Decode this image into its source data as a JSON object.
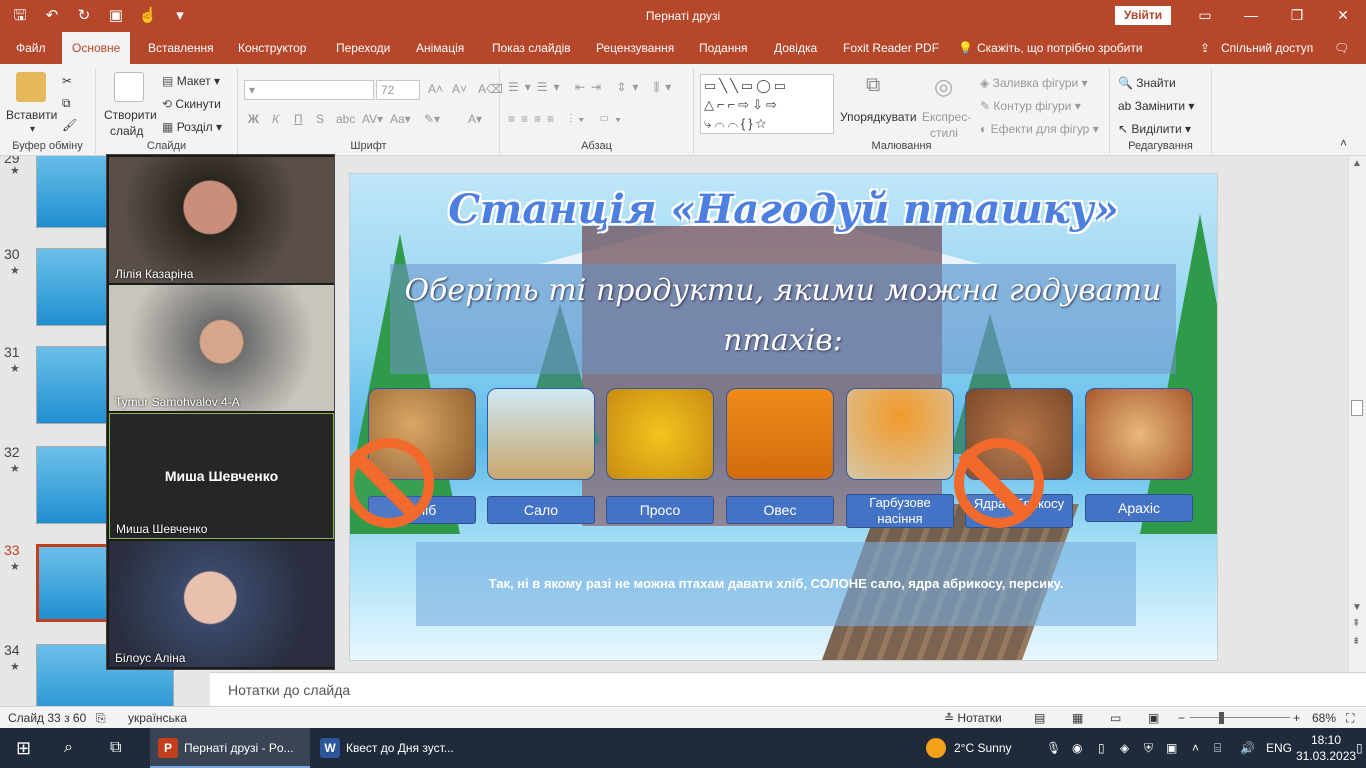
{
  "app": {
    "title": "Пернаті друзі",
    "signin": "Увійти"
  },
  "tabs": [
    "Файл",
    "Основне",
    "Вставлення",
    "Конструктор",
    "Переходи",
    "Анімація",
    "Показ слайдів",
    "Рецензування",
    "Подання",
    "Довідка",
    "Foxit Reader PDF",
    "Скажіть, що потрібно зробити",
    "Спільний доступ"
  ],
  "ribbon": {
    "paste": "Вставити",
    "clipboard": "Буфер обміну",
    "new_slide": "Створити",
    "new_slide2": "слайд",
    "layout": "Макет",
    "reset": "Скинути",
    "section": "Розділ",
    "slides": "Слайди",
    "font_size": "72",
    "bold": "Ж",
    "italic": "К",
    "underline": "П",
    "strike": "S",
    "font": "Шрифт",
    "paragraph": "Абзац",
    "arrange": "Упорядкувати",
    "quick_styles": "Експрес-",
    "quick_styles2": "стилі",
    "fill": "Заливка фігури",
    "outline": "Контур фігури",
    "effects": "Ефекти для фігур",
    "drawing": "Малювання",
    "find": "Знайти",
    "replace": "Замінити",
    "select": "Виділити",
    "editing": "Редагування"
  },
  "thumbnails": [
    {
      "num": "29"
    },
    {
      "num": "30"
    },
    {
      "num": "31"
    },
    {
      "num": "32"
    },
    {
      "num": "33"
    },
    {
      "num": "34"
    }
  ],
  "video": {
    "p1": "Лілія Казаріна",
    "p2": "Tymur Samohvalov 4-А",
    "p3_center": "Миша Шевченко",
    "p3": "Миша Шевченко",
    "p4": "Білоус Аліна"
  },
  "slide": {
    "title": "Станція «Нагодуй пташку»",
    "question": "Оберіть ті продукти, якими можна годувати птахів:",
    "foods": [
      "Хліб",
      "Сало",
      "Просо",
      "Овес",
      "Гарбузове насіння",
      "Ядра абрикосу",
      "Арахіс"
    ],
    "answer": "Так, ні в якому разі не можна птахам давати хліб, СОЛОНЕ сало, ядра абрикосу, персику."
  },
  "notes": "Нотатки до слайда",
  "status": {
    "slide": "Слайд 33 з 60",
    "lang": "українська",
    "notes_btn": "Нотатки",
    "zoom": "68%"
  },
  "taskbar": {
    "app1": "Пернаті друзі - Po...",
    "app2": "Квест  до Дня зуст...",
    "weather": "2°C  Sunny",
    "lang": "ENG",
    "time": "18:10",
    "date": "31.03.2023"
  }
}
